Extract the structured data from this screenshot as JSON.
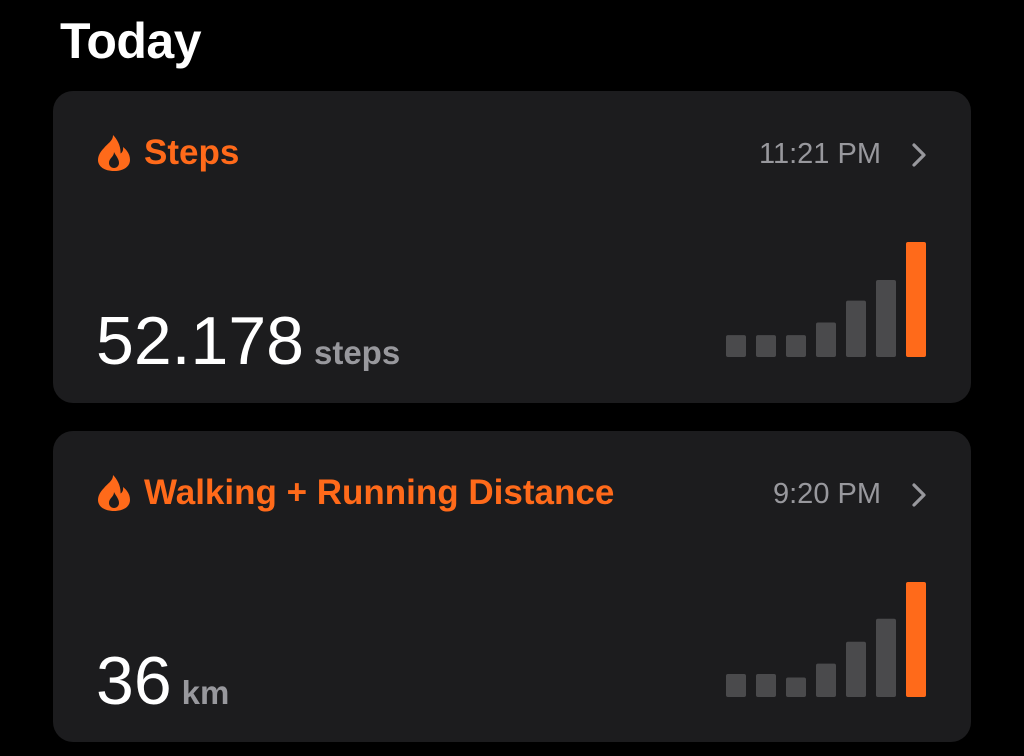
{
  "page": {
    "title": "Today"
  },
  "colors": {
    "accent": "#ff6a1a",
    "bar_muted": "#4a4a4c",
    "card_bg": "#1c1c1e",
    "secondary_text": "#98989d"
  },
  "cards": [
    {
      "title": "Steps",
      "icon": "flame-icon",
      "time": "11:21 PM",
      "value": "52.178",
      "unit": "steps",
      "bars": [
        0.19,
        0.19,
        0.19,
        0.3,
        0.49,
        0.67,
        1.0
      ]
    },
    {
      "title": "Walking + Running Distance",
      "icon": "flame-icon",
      "time": "9:20 PM",
      "value": "36",
      "unit": "km",
      "bars": [
        0.2,
        0.2,
        0.17,
        0.29,
        0.48,
        0.68,
        1.0
      ]
    }
  ]
}
